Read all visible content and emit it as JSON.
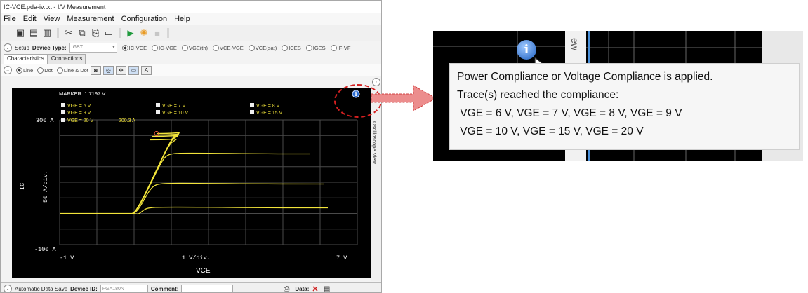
{
  "window": {
    "title": "IC-VCE.pda-iv.txt - I/V Measurement",
    "menu": [
      "File",
      "Edit",
      "View",
      "Measurement",
      "Configuration",
      "Help"
    ]
  },
  "setup": {
    "label": "Setup",
    "device_type_label": "Device Type:",
    "device_type_value": "IGBT",
    "modes": [
      "IC-VCE",
      "IC-VGE",
      "VGE(th)",
      "VCE-VGE",
      "VCE(sat)",
      "ICES",
      "IGES",
      "IF-VF"
    ],
    "selected_mode": "IC-VCE"
  },
  "tabs": [
    "Characteristics",
    "Connections"
  ],
  "display_options": {
    "modes": [
      "Line",
      "Dot",
      "Line & Dot"
    ],
    "selected": "Line"
  },
  "graph": {
    "marker": "MARKER: 1.7197 V",
    "legend": [
      {
        "label": "VGE = 6 V"
      },
      {
        "label": "VGE = 7 V"
      },
      {
        "label": "VGE = 8 V"
      },
      {
        "label": "VGE = 9 V"
      },
      {
        "label": "VGE = 10 V"
      },
      {
        "label": "VGE = 15 V"
      },
      {
        "label": "VGE = 20 V"
      }
    ],
    "marker_value": "200.3 A",
    "y_top": "300  A",
    "y_bottom": "-100  A",
    "y_div": "50  A/div.",
    "y_label": "IC",
    "x_left": "-1  V",
    "x_right": "7  V",
    "x_div": "1  V/div.",
    "x_label": "VCE",
    "trace_color": "#f2e43a"
  },
  "side_tab": "Oscilloscope View",
  "bottom": {
    "auto_save": "Automatic Data Save",
    "device_id_label": "Device ID:",
    "device_id_value": "FGA180N",
    "comment_label": "Comment:",
    "data_label": "Data:"
  },
  "tooltip": {
    "lines": [
      "Power Compliance or Voltage Compliance is applied.",
      "Trace(s) reached the compliance:",
      " VGE = 6 V, VGE = 7 V, VGE = 8 V, VGE = 9 V",
      " VGE = 10 V, VGE = 15 V, VGE = 20 V"
    ],
    "zoom_tab_text": "ew",
    "zoom_tab_text_lower": "O"
  },
  "colors": {
    "highlight": "#d42020",
    "arrow": "#e07070",
    "info_icon": "#2a6bd0"
  }
}
